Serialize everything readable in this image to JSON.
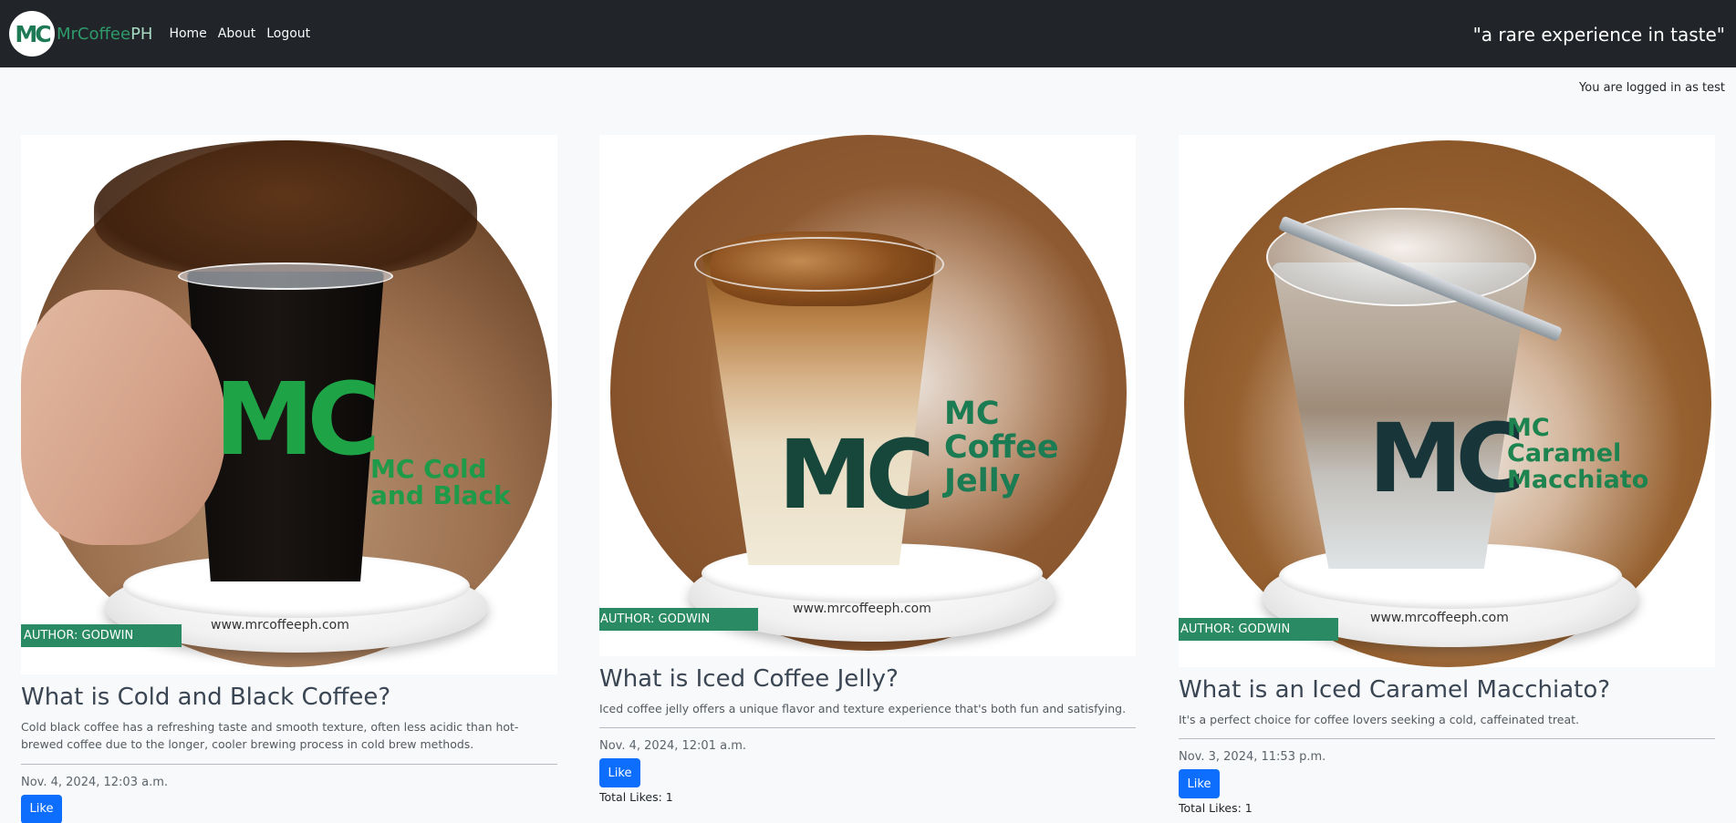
{
  "navbar": {
    "logo_letters": "MC",
    "brand_main": "MrCoffee",
    "brand_suffix": "PH",
    "links": [
      "Home",
      "About",
      "Logout"
    ],
    "tagline": "\"a rare experience in taste\""
  },
  "login_note": "You are logged in as test",
  "posts": [
    {
      "image_label_line1": "MC Cold",
      "image_label_line2": "and Black",
      "image_label_line3": "",
      "website": "www.mrcoffeeph.com",
      "author": "AUTHOR: GODWIN",
      "title": "What is Cold and Black Coffee?",
      "text": "Cold black coffee has a refreshing taste and smooth texture, often less acidic than hot-brewed coffee due to the longer, cooler brewing process in cold brew methods.",
      "date": "Nov. 4, 2024, 12:03 a.m.",
      "like_label": "Like",
      "total_likes": ""
    },
    {
      "image_label_line1": "MC",
      "image_label_line2": "Coffee",
      "image_label_line3": "Jelly",
      "website": "www.mrcoffeeph.com",
      "author": "AUTHOR: GODWIN",
      "title": "What is Iced Coffee Jelly?",
      "text": "Iced coffee jelly offers a unique flavor and texture experience that's both fun and satisfying.",
      "date": "Nov. 4, 2024, 12:01 a.m.",
      "like_label": "Like",
      "total_likes": "Total Likes: 1"
    },
    {
      "image_label_line1": "MC",
      "image_label_line2": "Caramel",
      "image_label_line3": "Macchiato",
      "website": "www.mrcoffeeph.com",
      "author": "AUTHOR: GODWIN",
      "title": "What is an Iced Caramel Macchiato?",
      "text": "It's a perfect choice for coffee lovers seeking a cold, caffeinated treat.",
      "date": "Nov. 3, 2024, 11:53 p.m.",
      "like_label": "Like",
      "total_likes": "Total Likes: 1"
    }
  ]
}
